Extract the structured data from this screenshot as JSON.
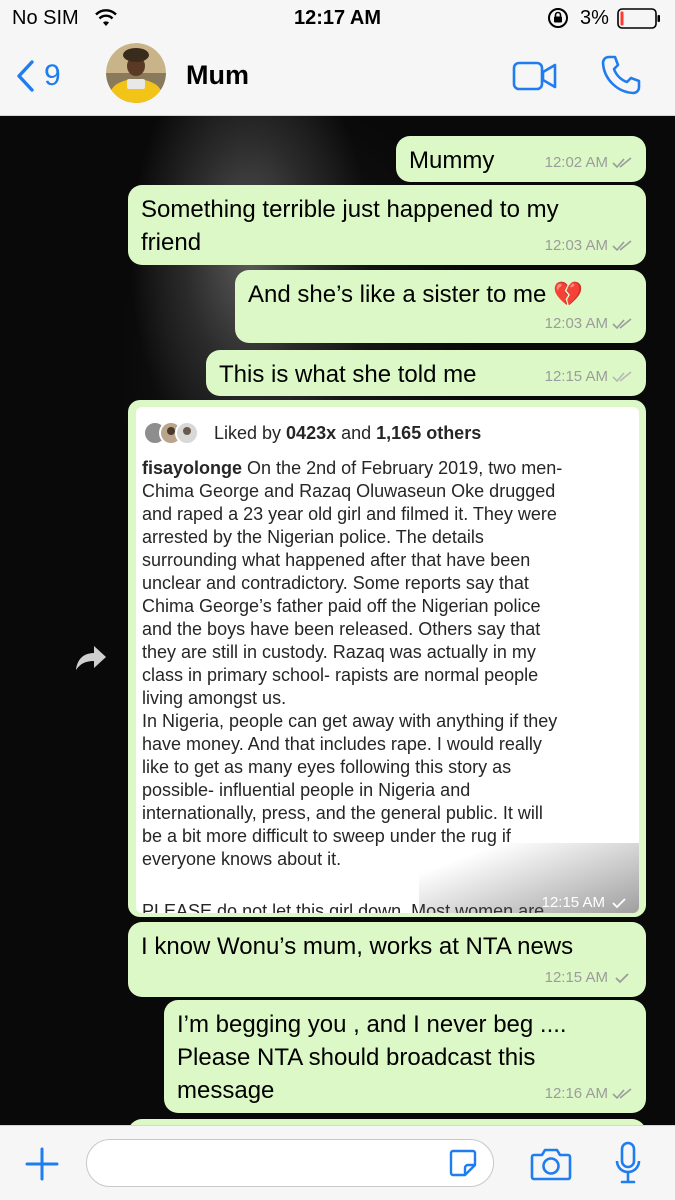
{
  "status_bar": {
    "carrier": "No SIM",
    "time": "12:17 AM",
    "battery": "3%",
    "battery_color": "#ff3b30"
  },
  "header": {
    "back_count": "9",
    "contact_name": "Mum",
    "accent_color": "#1f7df0",
    "icons": [
      "back-chevron-icon",
      "video-call-icon",
      "phone-icon"
    ]
  },
  "messages": [
    {
      "text": "Mummy",
      "time": "12:02 AM",
      "status": "read"
    },
    {
      "lines": [
        "Something terrible just happened to my",
        "friend"
      ],
      "time": "12:03 AM",
      "status": "read"
    },
    {
      "text": "And she’s like a sister to me 💔",
      "time": "12:03 AM",
      "status": "read"
    },
    {
      "text": "This is what she told me",
      "time": "12:15 AM",
      "status": "read"
    },
    {
      "text": "I know Wonu’s mum, works at NTA news",
      "time": "12:15 AM",
      "status": "delivered"
    },
    {
      "lines": [
        "I’m begging you , and I never beg ....",
        "Please NTA should broadcast this",
        "message"
      ],
      "time": "12:16 AM",
      "status": "read"
    }
  ],
  "forwarded_post": {
    "time": "12:15 AM",
    "liked_prefix": "Liked by",
    "liked_user": "0423x",
    "liked_and": "and",
    "liked_others": "1,165 others",
    "username": "fisayolonge",
    "paragraph1_lines": [
      "On the 2nd of February 2019, two men-",
      "Chima George and Razaq Oluwaseun Oke drugged",
      "and raped a 23 year old girl and filmed it. They were",
      "arrested by the Nigerian police. The details",
      "surrounding what happened after that have been",
      "unclear and contradictory. Some reports say that",
      "Chima George’s father paid off the Nigerian police",
      "and the boys have been released. Others say that",
      "they are still in custody. Razaq was actually in my",
      "class in primary school- rapists are normal people",
      "living amongst us."
    ],
    "paragraph2_lines": [
      "In Nigeria, people can get away with anything if they",
      "have money. And that includes rape. I would really",
      "like to get as many eyes following this story as",
      "possible- influential people in Nigeria and",
      "internationally, press, and the general public. It will",
      "be a bit more difficult to sweep under the rug if",
      "everyone knows about it."
    ],
    "cut_line": "PLEASE do not let this girl down. Most women are"
  },
  "composer": {
    "placeholder": "",
    "icons": [
      "plus-icon",
      "sticker-icon",
      "camera-icon",
      "microphone-icon"
    ]
  },
  "colors": {
    "bubble_outgoing": "#dcf8c6",
    "read_ticks": "#9c9c9c",
    "bar_background": "#f6f6f6"
  }
}
